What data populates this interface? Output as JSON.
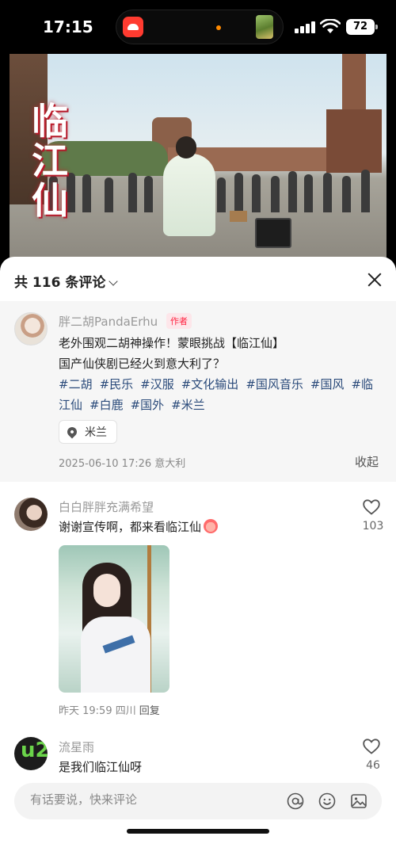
{
  "status_bar": {
    "time": "17:15",
    "battery": "72"
  },
  "video": {
    "title_chars": [
      "临",
      "江",
      "仙"
    ]
  },
  "comments_sheet": {
    "count_label": "共 116 条评论",
    "author_post": {
      "name": "胖二胡PandaErhu",
      "badge": "作者",
      "text_line1": "老外围观二胡神操作！蒙眼挑战【临江仙】",
      "text_line2": "国产仙侠剧已经火到意大利了？",
      "hashtags": [
        "#二胡",
        "#民乐",
        "#汉服",
        "#文化输出",
        "#国风音乐",
        "#国风",
        "#临江仙",
        "#白鹿",
        "#国外",
        "#米兰"
      ],
      "location": "米兰",
      "meta": "2025-06-10 17:26 意大利",
      "collapse": "收起"
    },
    "comments": [
      {
        "name": "白白胖胖充满希望",
        "text": "谢谢宣传啊，都来看临江仙",
        "likes": "103",
        "meta": "昨天 19:59 四川",
        "reply": "回复"
      },
      {
        "name": "流星雨",
        "text": "是我们临江仙呀",
        "likes": "46"
      }
    ],
    "input": {
      "placeholder": "有话要说，快来评论"
    }
  }
}
